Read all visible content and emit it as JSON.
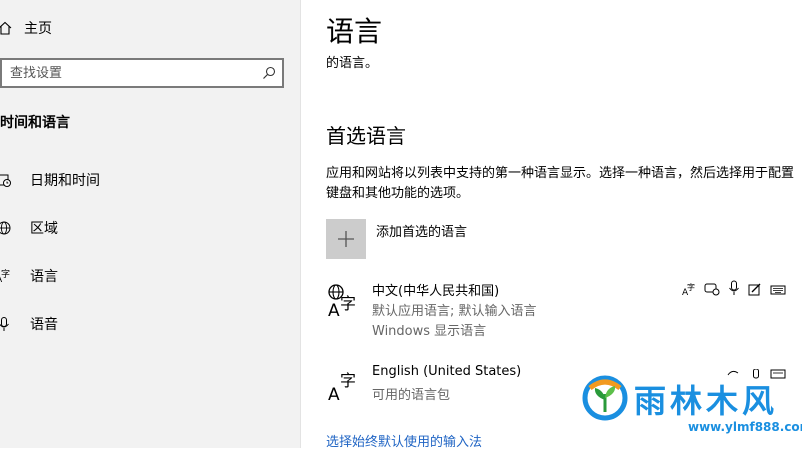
{
  "sidebar": {
    "home_label": "主页",
    "search_placeholder": "查找设置",
    "section_title": "时间和语言",
    "items": [
      {
        "label": "日期和时间",
        "icon": "clock-calendar-icon"
      },
      {
        "label": "区域",
        "icon": "globe-region-icon"
      },
      {
        "label": "语言",
        "icon": "language-icon"
      },
      {
        "label": "语音",
        "icon": "microphone-icon"
      }
    ]
  },
  "main": {
    "title": "语言",
    "subtitle": "的语言。",
    "preferred_heading": "首选语言",
    "description": "应用和网站将以列表中支持的第一种语言显示。选择一种语言，然后选择用于配置键盘和其他功能的选项。",
    "add_label": "添加首选的语言",
    "languages": [
      {
        "name": "中文(中华人民共和国)",
        "sub1": "默认应用语言; 默认输入语言",
        "sub2": "Windows 显示语言"
      },
      {
        "name": "English (United States)",
        "sub1": "可用的语言包",
        "sub2": ""
      }
    ],
    "bottom_link": "选择始终默认使用的输入法"
  },
  "watermark": {
    "brand": "雨林木风",
    "url": "www.ylmf888.com"
  },
  "colors": {
    "sidebar_bg": "#f2f2f2",
    "link": "#1f64c4",
    "add_button": "#cccccc",
    "watermark": "#1a8fe0"
  }
}
